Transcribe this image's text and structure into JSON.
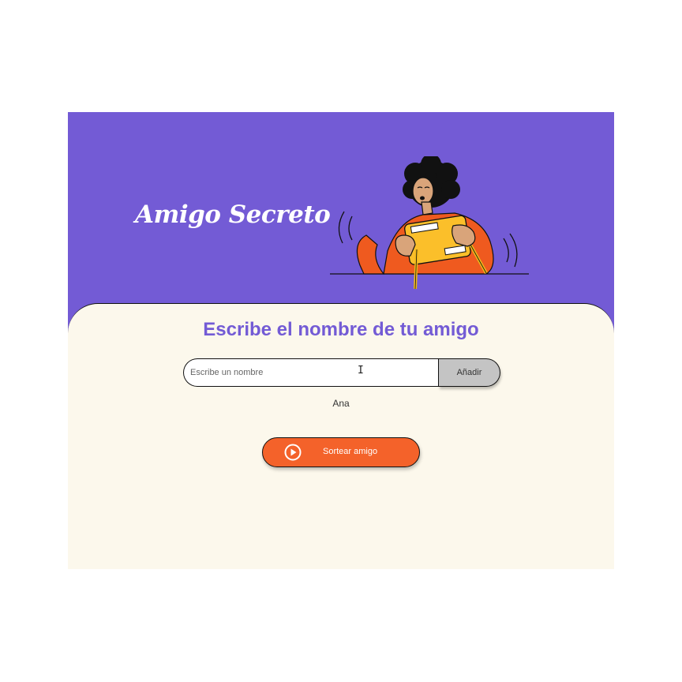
{
  "header": {
    "title": "Amigo Secreto",
    "illustration": "person-playing-handheld-console-illustration"
  },
  "main": {
    "heading": "Escribe el nombre de tu amigo",
    "input": {
      "placeholder": "Escribe un nombre",
      "value": ""
    },
    "add_button_label": "Añadir",
    "friends": [
      "Ana"
    ],
    "draw_button_label": "Sortear amigo",
    "draw_button_icon": "play-circle-icon"
  },
  "colors": {
    "header_bg": "#735bd5",
    "panel_bg": "#fcf8ec",
    "accent": "#735bd5",
    "draw_button": "#f4622a",
    "add_button": "#c4c4c4"
  }
}
